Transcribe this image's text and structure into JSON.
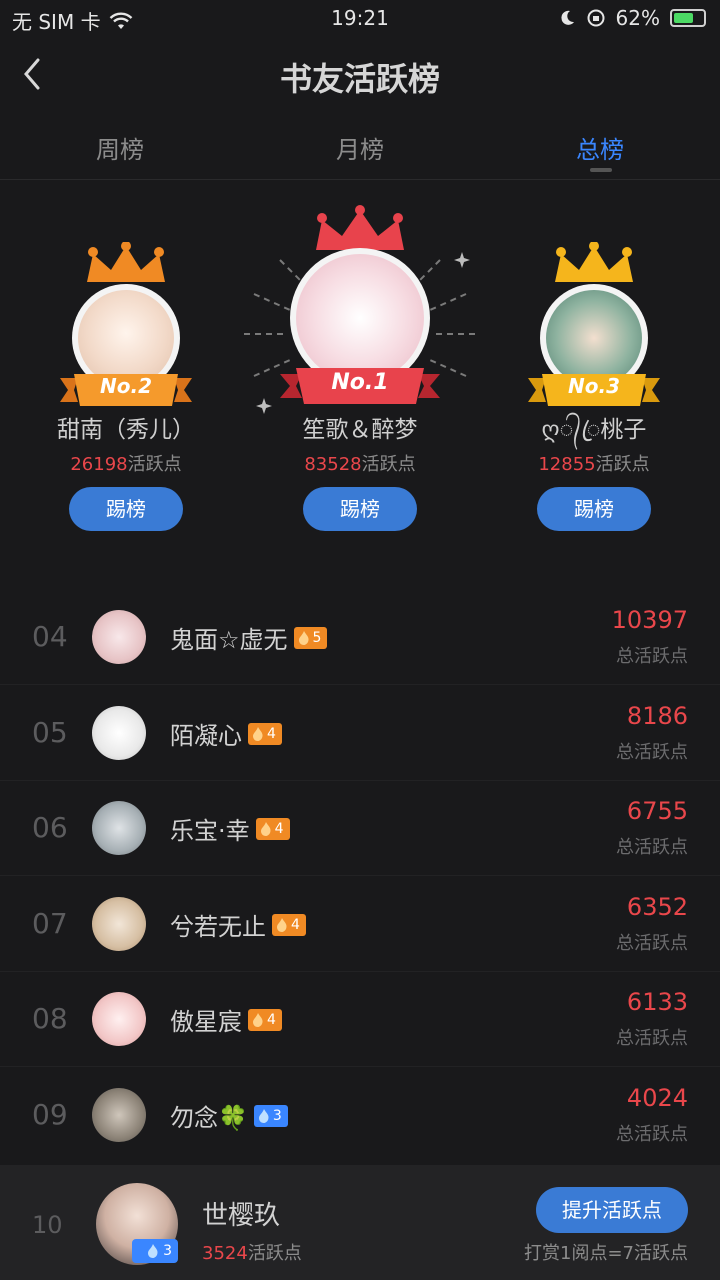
{
  "status_bar": {
    "carrier": "无 SIM 卡",
    "time": "19:21",
    "battery": "62%",
    "icons": [
      "wifi-icon",
      "moon-icon",
      "orientation-lock-icon",
      "battery-icon"
    ]
  },
  "header": {
    "title": "书友活跃榜",
    "back_icon": "chevron-left-icon"
  },
  "tabs": [
    {
      "label": "周榜",
      "active": false
    },
    {
      "label": "月榜",
      "active": false
    },
    {
      "label": "总榜",
      "active": true
    }
  ],
  "colors": {
    "accent": "#3a86ff",
    "points": "#e9474b",
    "gold": "#f5a623",
    "red": "#e8434c",
    "orange": "#f08a24"
  },
  "podium": {
    "first": {
      "badge": "No.1",
      "name": "笙歌＆醉梦",
      "points": "83528",
      "unit": "活跃点",
      "button": "踢榜"
    },
    "second": {
      "badge": "No.2",
      "name": "甜南（秀儿）",
      "points": "26198",
      "unit": "活跃点",
      "button": "踢榜"
    },
    "third": {
      "badge": "No.3",
      "name": "ღ᭄ꦿ桃子",
      "points": "12855",
      "unit": "活跃点",
      "button": "踢榜"
    }
  },
  "list": [
    {
      "rank": "04",
      "name": "鬼面☆虚无",
      "level": "5",
      "level_color": "orange",
      "value": "10397",
      "label": "总活跃点"
    },
    {
      "rank": "05",
      "name": "陌凝心",
      "level": "4",
      "level_color": "orange",
      "value": "8186",
      "label": "总活跃点"
    },
    {
      "rank": "06",
      "name": "乐宝·幸",
      "level": "4",
      "level_color": "orange",
      "value": "6755",
      "label": "总活跃点"
    },
    {
      "rank": "07",
      "name": "兮若无止",
      "level": "4",
      "level_color": "orange",
      "value": "6352",
      "label": "总活跃点"
    },
    {
      "rank": "08",
      "name": "傲星宸",
      "level": "4",
      "level_color": "orange",
      "value": "6133",
      "label": "总活跃点"
    },
    {
      "rank": "09",
      "name": "勿念🍀",
      "level": "3",
      "level_color": "blue",
      "value": "4024",
      "label": "总活跃点"
    }
  ],
  "me": {
    "rank": "10",
    "name": "世樱玖",
    "level": "3",
    "points": "3524",
    "unit": "活跃点",
    "button": "提升活跃点",
    "note": "打赏1阅点=7活跃点"
  }
}
